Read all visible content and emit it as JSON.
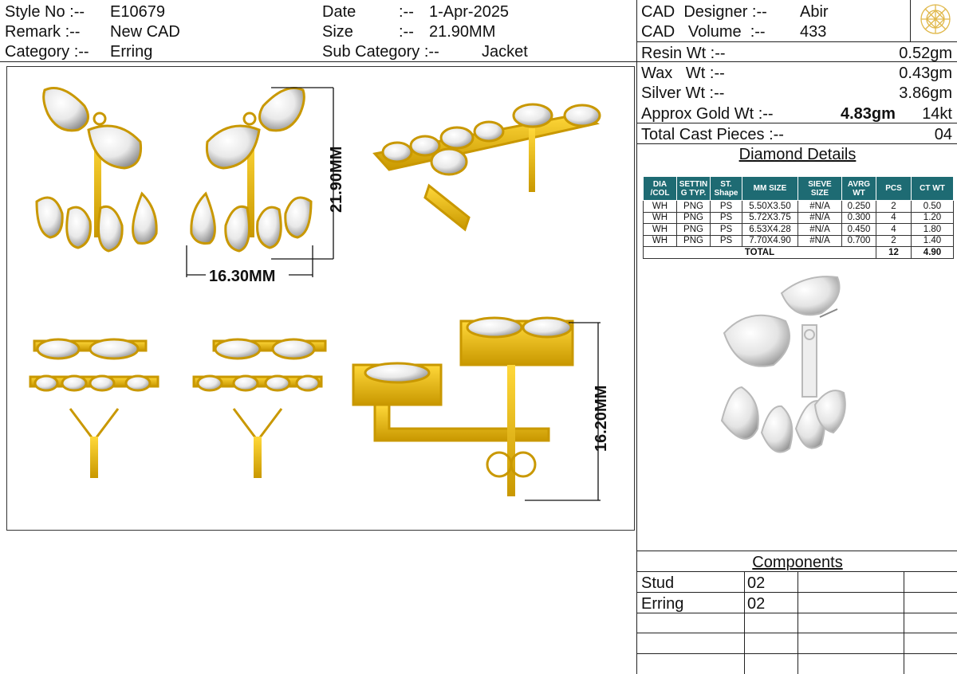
{
  "header": {
    "style_no_label": "Style No :--",
    "style_no_value": "E10679",
    "remark_label": "Remark :--",
    "remark_value": "New CAD",
    "category_label": "Category :--",
    "category_value": "Erring",
    "date_label": "Date",
    "date_sep": ":--",
    "date_value": "1-Apr-2025",
    "size_label": "Size",
    "size_sep": ":--",
    "size_value": "21.90MM",
    "sub_category_label": "Sub Category :--",
    "sub_category_value": "Jacket",
    "cad_designer_label": "CAD  Designer :--",
    "cad_designer_value": "Abir",
    "cad_volume_label": "CAD   Volume  :--",
    "cad_volume_value": "433"
  },
  "weights": {
    "resin_label": "Resin Wt :--",
    "resin_value": "0.52gm",
    "wax_label": "Wax   Wt :--",
    "wax_value": "0.43gm",
    "silver_label": "Silver Wt :--",
    "silver_value": "3.86gm",
    "gold_label": "Approx Gold Wt :--",
    "gold_value": "4.83gm",
    "gold_karat": "14kt",
    "cast_label": "Total Cast Pieces :--",
    "cast_value": "04"
  },
  "diamond_details": {
    "title": "Diamond Details",
    "headers": [
      "DIA /COL",
      "SETTIN G TYP.",
      "ST. Shape",
      "MM SIZE",
      "SIEVE SIZE",
      "AVRG WT",
      "PCS",
      "CT WT"
    ],
    "rows": [
      [
        "WH",
        "PNG",
        "PS",
        "5.50X3.50",
        "#N/A",
        "0.250",
        "2",
        "0.50"
      ],
      [
        "WH",
        "PNG",
        "PS",
        "5.72X3.75",
        "#N/A",
        "0.300",
        "4",
        "1.20"
      ],
      [
        "WH",
        "PNG",
        "PS",
        "6.53X4.28",
        "#N/A",
        "0.450",
        "4",
        "1.80"
      ],
      [
        "WH",
        "PNG",
        "PS",
        "7.70X4.90",
        "#N/A",
        "0.700",
        "2",
        "1.40"
      ]
    ],
    "total_label": "TOTAL",
    "total_pcs": "12",
    "total_ct": "4.90"
  },
  "dimensions": {
    "height_front": "21.90MM",
    "width_front": "16.30MM",
    "height_side": "16.20MM"
  },
  "components": {
    "title": "Components",
    "rows": [
      [
        "Stud",
        "02"
      ],
      [
        "Erring",
        "02"
      ],
      [
        "",
        ""
      ],
      [
        "",
        ""
      ],
      [
        "",
        ""
      ]
    ]
  },
  "colors": {
    "gold": "#f2c200",
    "gold_dark": "#b88a00",
    "table_header": "#1e6b73",
    "logo": "#e0b84a"
  },
  "icons": [
    "brand-logo-icon"
  ]
}
